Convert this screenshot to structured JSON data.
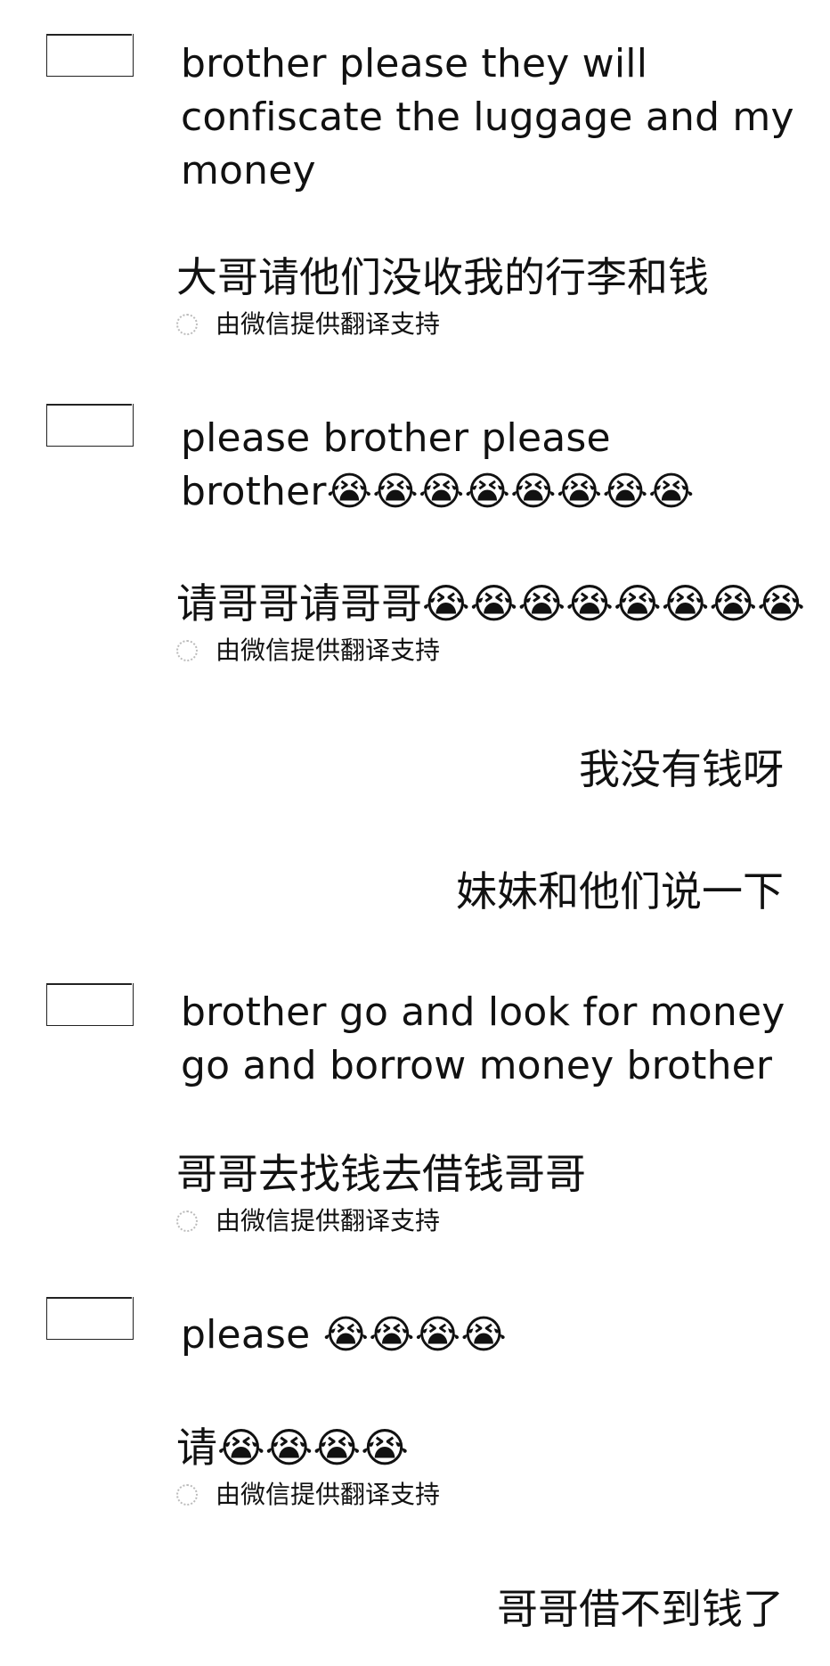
{
  "messages": [
    {
      "text": "brother please they will confiscate the luggage and my money",
      "translation": "大哥请他们没收我的行李和钱",
      "credit": "由微信提供翻译支持"
    },
    {
      "text": "please brother please brother😭😭😭😭😭😭😭😭",
      "translation": "请哥哥请哥哥😭😭😭😭😭😭😭😭",
      "credit": "由微信提供翻译支持"
    },
    {
      "text": "brother go and look for money go and borrow money brother",
      "translation": "哥哥去找钱去借钱哥哥",
      "credit": "由微信提供翻译支持"
    },
    {
      "text": "please 😭😭😭😭",
      "translation": "请😭😭😭😭",
      "credit": "由微信提供翻译支持"
    }
  ],
  "sent": [
    "我没有钱呀",
    "妹妹和他们说一下",
    "哥哥借不到钱了"
  ]
}
